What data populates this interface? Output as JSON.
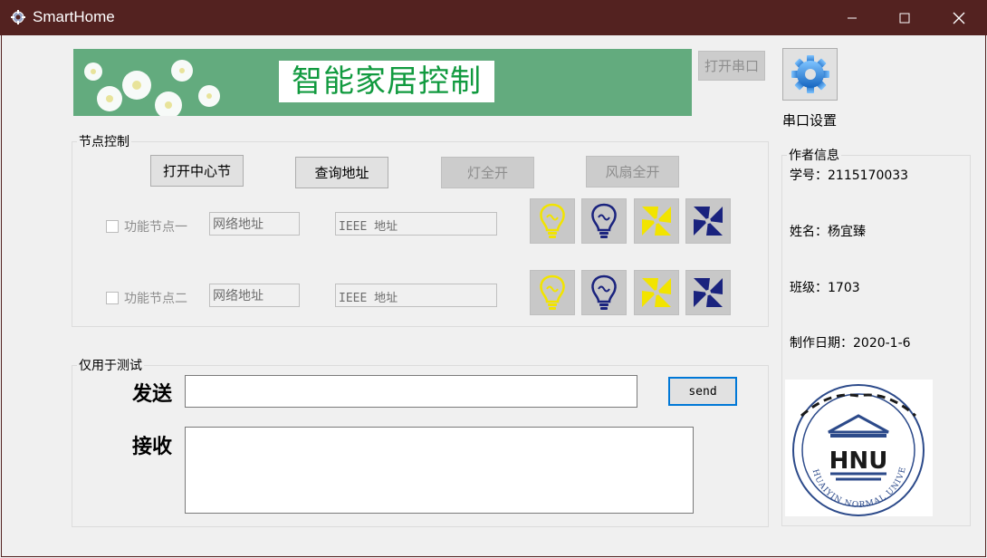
{
  "window": {
    "title": "SmartHome",
    "controls": [
      "minimize-icon",
      "maximize-icon",
      "close-icon"
    ]
  },
  "banner": {
    "title": "智能家居控制"
  },
  "serial": {
    "open_button": "打开串口",
    "settings_label": "串口设置",
    "settings_icon": "gear-icon"
  },
  "node_control": {
    "group_title": "节点控制",
    "buttons": {
      "open_center": "打开中心节",
      "query_address": "查询地址",
      "lights_all_on": "灯全开",
      "fans_all_on": "风扇全开"
    },
    "nodes": [
      {
        "label": "功能节点一",
        "checked": false,
        "network_address": "网络地址",
        "ieee_address": "IEEE 地址",
        "icons": [
          "bulb-on-icon",
          "bulb-off-icon",
          "fan-on-icon",
          "fan-off-icon"
        ]
      },
      {
        "label": "功能节点二",
        "checked": false,
        "network_address": "网络地址",
        "ieee_address": "IEEE 地址",
        "icons": [
          "bulb-on-icon",
          "bulb-off-icon",
          "fan-on-icon",
          "fan-off-icon"
        ]
      }
    ]
  },
  "test": {
    "group_title": "仅用于测试",
    "send_label": "发送",
    "receive_label": "接收",
    "send_value": "",
    "receive_value": "",
    "send_button": "send"
  },
  "author": {
    "group_title": "作者信息",
    "student_id": "学号：2115170033",
    "name": "姓名：杨宜臻",
    "class": "班级：1703",
    "date": "制作日期：2020-1-6",
    "logo_text": "HNU",
    "logo_ring_text": "HUAIYIN NORMAL UNIVERSITY"
  },
  "colors": {
    "titlebar": "#532220",
    "banner": "#63ab7e",
    "banner_text": "#119a3f",
    "bulb_on": "#f2e400",
    "bulb_off": "#1a237e",
    "fan_on": "#f2e400",
    "fan_off": "#1a237e",
    "accent": "#0078d7",
    "logo_blue": "#2c4a8a"
  }
}
